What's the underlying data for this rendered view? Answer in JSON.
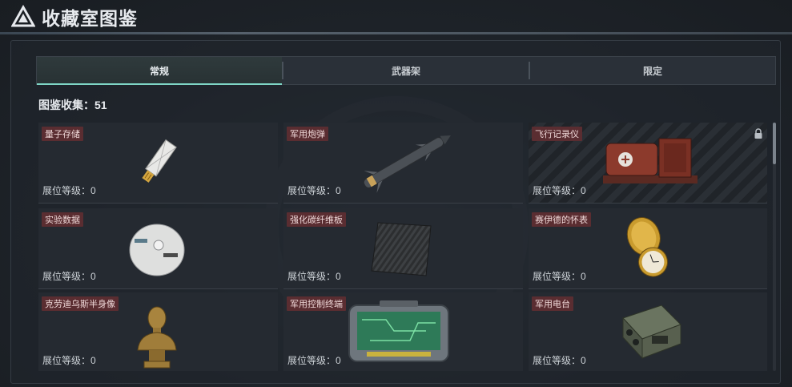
{
  "header": {
    "title": "收藏室图鉴",
    "logo_icon": "triangle-logo-icon"
  },
  "tabs": [
    {
      "label": "常规",
      "active": true
    },
    {
      "label": "武器架",
      "active": false
    },
    {
      "label": "限定",
      "active": false
    }
  ],
  "collection": {
    "count_label": "图鉴收集：51"
  },
  "items": [
    {
      "name": "量子存储",
      "level_label": "展位等级：0",
      "icon": "usb-drive-icon",
      "locked": false
    },
    {
      "name": "军用炮弹",
      "level_label": "展位等级：0",
      "icon": "missile-shell-icon",
      "locked": false
    },
    {
      "name": "飞行记录仪",
      "level_label": "展位等级：0",
      "icon": "flight-recorder-icon",
      "locked": true
    },
    {
      "name": "实验数据",
      "level_label": "展位等级：0",
      "icon": "data-disc-icon",
      "locked": false
    },
    {
      "name": "强化碳纤维板",
      "level_label": "展位等级：0",
      "icon": "carbon-fiber-plate-icon",
      "locked": false
    },
    {
      "name": "赛伊德的怀表",
      "level_label": "展位等级：0",
      "icon": "pocket-watch-icon",
      "locked": false
    },
    {
      "name": "克劳迪乌斯半身像",
      "level_label": "展位等级：0",
      "icon": "bronze-bust-icon",
      "locked": false
    },
    {
      "name": "军用控制终端",
      "level_label": "展位等级：0",
      "icon": "control-terminal-icon",
      "locked": false
    },
    {
      "name": "军用电台",
      "level_label": "展位等级：0",
      "icon": "military-radio-icon",
      "locked": false
    }
  ],
  "colors": {
    "accent": "#7fd6c6",
    "name_tag_bg": "#5a2d31",
    "background": "#1d2228"
  }
}
